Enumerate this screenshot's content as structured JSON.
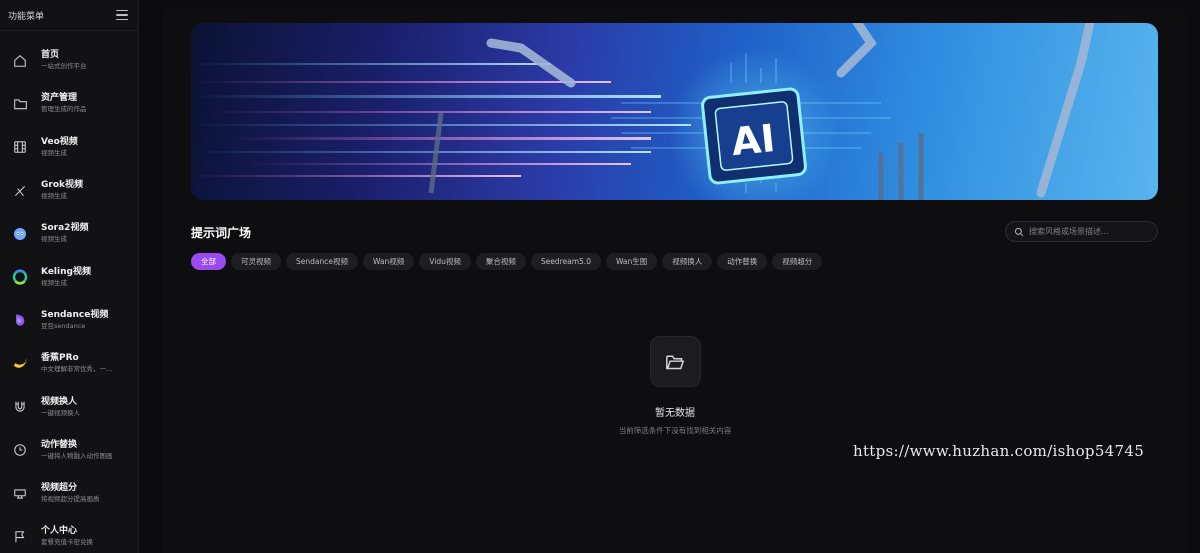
{
  "sidebar": {
    "title": "功能菜单",
    "items": [
      {
        "label": "首页",
        "sub": "一站式创作平台",
        "icon": "home-icon"
      },
      {
        "label": "资产管理",
        "sub": "管理生成的作品",
        "icon": "folder-icon"
      },
      {
        "label": "Veo视频",
        "sub": "视频生成",
        "icon": "film-icon"
      },
      {
        "label": "Grok视频",
        "sub": "视频生成",
        "icon": "grok-icon"
      },
      {
        "label": "Sora2视频",
        "sub": "视频生成",
        "icon": "sora-icon"
      },
      {
        "label": "Keling视频",
        "sub": "视频生成",
        "icon": "keling-icon"
      },
      {
        "label": "Sendance视频",
        "sub": "豆包sendance",
        "icon": "sendance-icon"
      },
      {
        "label": "香蕉PRo",
        "sub": "中文理解非常优秀，一...",
        "icon": "banana-icon"
      },
      {
        "label": "视频换人",
        "sub": "一键视频换人",
        "icon": "magnet-icon"
      },
      {
        "label": "动作替换",
        "sub": "一键将人物融入动作图画",
        "icon": "clock-icon"
      },
      {
        "label": "视频超分",
        "sub": "将视频超分提高画质",
        "icon": "upscale-icon"
      },
      {
        "label": "个人中心",
        "sub": "套餐充值卡密兑换",
        "icon": "flag-icon"
      }
    ]
  },
  "main": {
    "section_title": "提示词广场",
    "search": {
      "placeholder": "搜索风格或场景描述..."
    },
    "filters": [
      "全部",
      "可灵视频",
      "Sendance视频",
      "Wan视频",
      "Vidu视频",
      "聚合视频",
      "Seedream5.0",
      "Wan生图",
      "视频换人",
      "动作替换",
      "视频超分"
    ],
    "active_filter_index": 0,
    "empty": {
      "title": "暂无数据",
      "subtitle": "当前筛选条件下没有找到相关内容"
    }
  },
  "banner": {
    "text": "AI"
  },
  "watermark": "https://www.huzhan.com/ishop54745",
  "colors": {
    "accent": "#9a4bf0",
    "background": "#0b0b0d",
    "panel": "#0e0e10"
  }
}
